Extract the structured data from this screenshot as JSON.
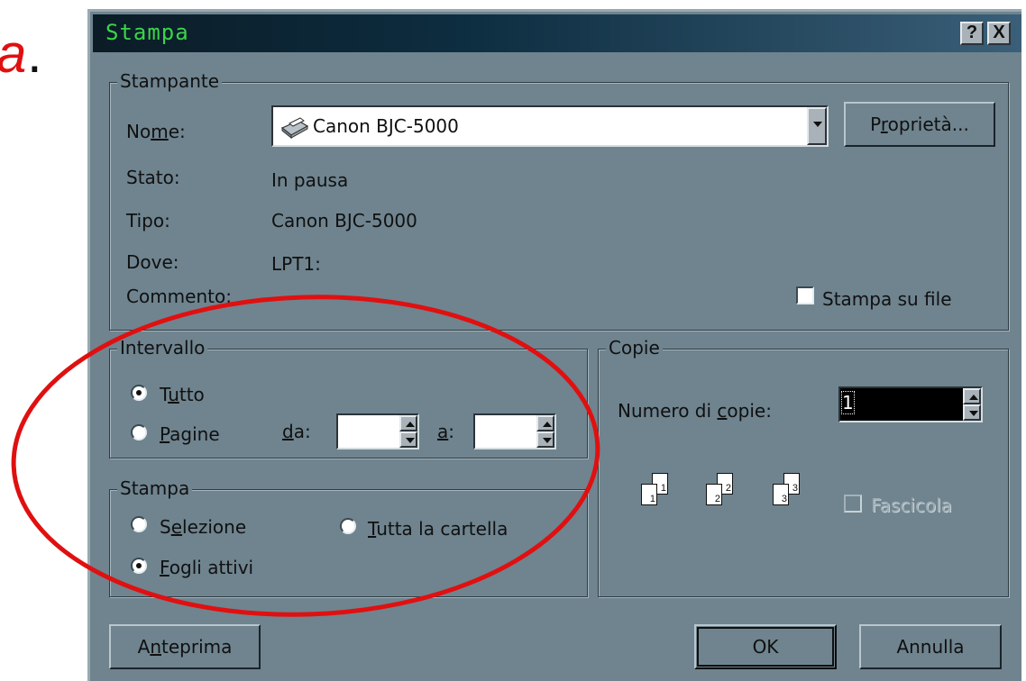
{
  "background_fragment": {
    "text": "a",
    "punct": "."
  },
  "window": {
    "title": "Stampa",
    "help_button": "?",
    "close_button": "X"
  },
  "printer": {
    "legend": "Stampante",
    "name_label": "Nome:",
    "name_value": "Canon BJC-5000",
    "properties_button": "Proprietà...",
    "status_label": "Stato:",
    "status_value": "In pausa",
    "type_label": "Tipo:",
    "type_value": "Canon BJC-5000",
    "where_label": "Dove:",
    "where_value": "LPT1:",
    "comment_label": "Commento:",
    "print_to_file_label": "Stampa su file",
    "print_to_file_checked": false
  },
  "range": {
    "legend": "Intervallo",
    "all_label": "Tutto",
    "all_selected": true,
    "pages_label": "Pagine",
    "from_label": "da:",
    "from_value": "",
    "to_label": "a:",
    "to_value": ""
  },
  "print_what": {
    "legend": "Stampa",
    "selection_label": "Selezione",
    "whole_workbook_label": "Tutta la cartella",
    "active_sheets_label": "Fogli attivi",
    "selected": "Fogli attivi"
  },
  "copies": {
    "legend": "Copie",
    "number_label": "Numero di copie:",
    "number_value": "1",
    "collate_label": "Fascicola",
    "collate_enabled": false,
    "page_numbers": [
      "1",
      "1",
      "2",
      "2",
      "3",
      "3"
    ]
  },
  "buttons": {
    "preview": "Anteprima",
    "ok": "OK",
    "cancel": "Annulla"
  },
  "colors": {
    "dialog_bg": "#6f848f",
    "title_text": "#3cd34a",
    "annotation_ellipse": "#e01010"
  },
  "annotation": {
    "shape": "ellipse",
    "color": "#e01010"
  }
}
